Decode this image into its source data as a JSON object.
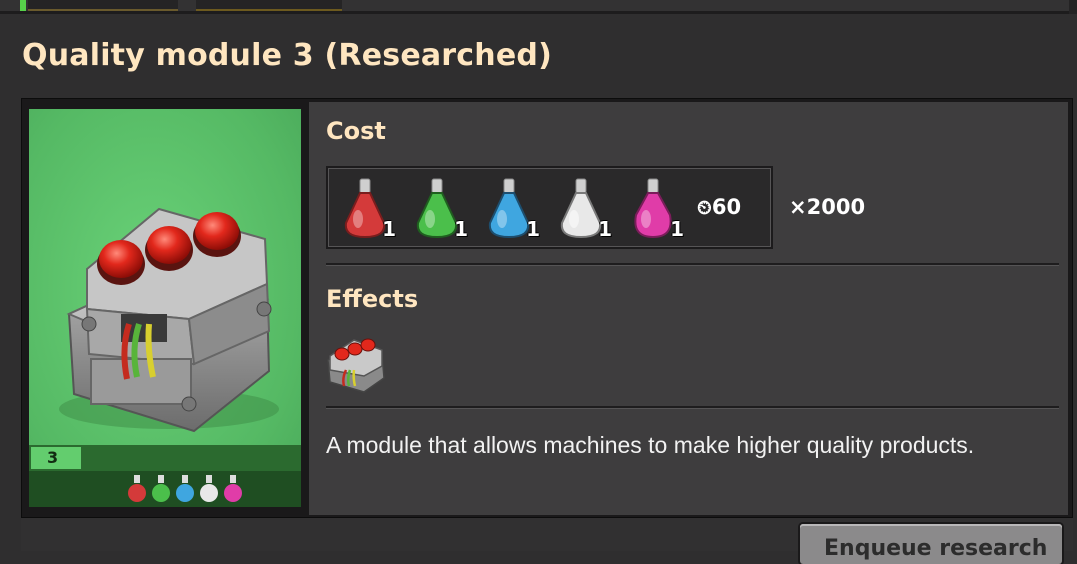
{
  "dialog": {
    "title": "Quality module 3 (Researched)",
    "card": {
      "level": "3",
      "pack_icons": [
        "automation-science-pack-icon",
        "logistic-science-pack-icon",
        "chemical-science-pack-icon",
        "space-science-pack-icon",
        "electromagnetic-science-pack-icon"
      ]
    },
    "cost": {
      "heading": "Cost",
      "packs": [
        {
          "icon": "automation-science-pack-icon",
          "color": "#d43a3a",
          "count": "1"
        },
        {
          "icon": "logistic-science-pack-icon",
          "color": "#4bbf4b",
          "count": "1"
        },
        {
          "icon": "chemical-science-pack-icon",
          "color": "#3fa6e0",
          "count": "1"
        },
        {
          "icon": "space-science-pack-icon",
          "color": "#e8e8e8",
          "count": "1"
        },
        {
          "icon": "electromagnetic-science-pack-icon",
          "color": "#e03ca8",
          "count": "1"
        }
      ],
      "time": "60",
      "multiplier": "2000"
    },
    "effects": {
      "heading": "Effects",
      "icon": "quality-module-3-icon"
    },
    "description": "A module that allows machines to make higher quality products.",
    "enqueue_label": "Enqueue research"
  }
}
